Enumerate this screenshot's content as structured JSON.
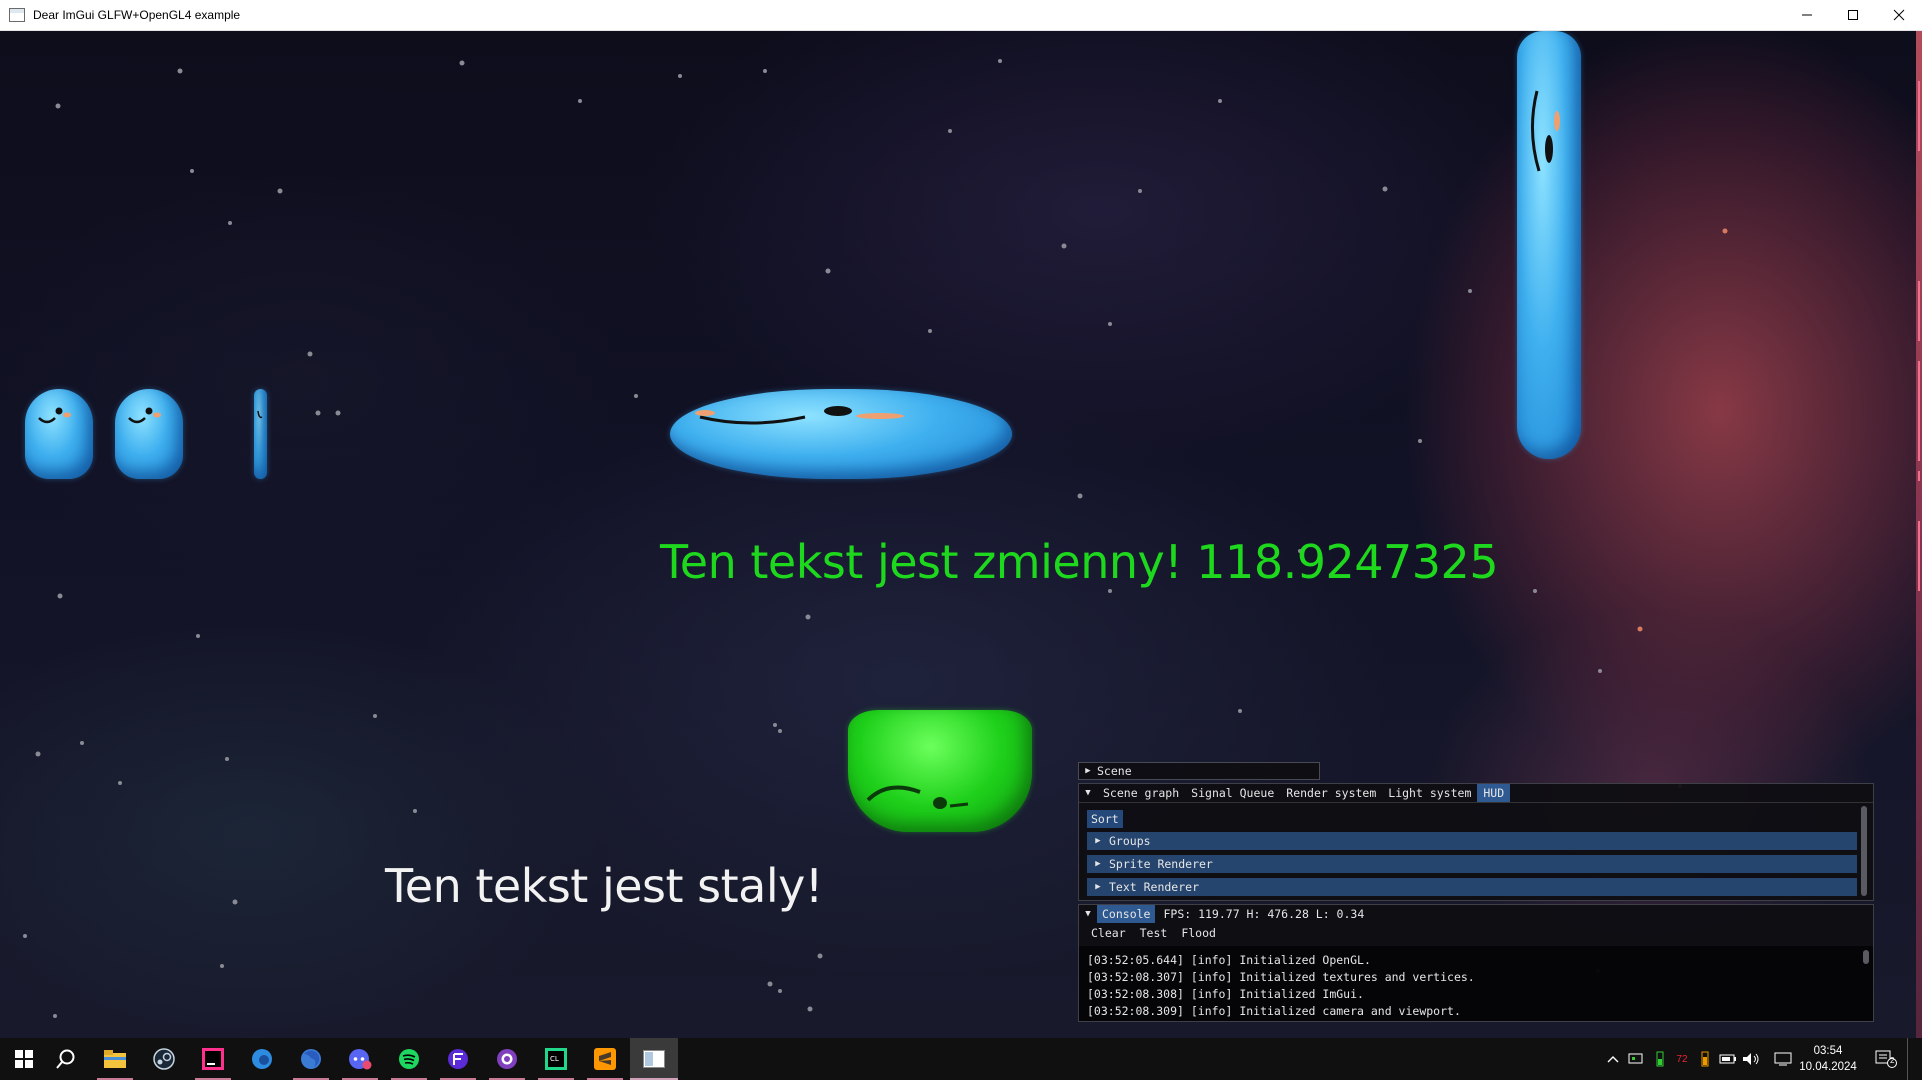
{
  "window": {
    "title": "Dear ImGui GLFW+OpenGL4 example"
  },
  "scene": {
    "dynamic_text": "Ten tekst jest zmienny! 118.9247325",
    "static_text": "Ten tekst jest staly!",
    "colors": {
      "dynamic_text": "#1ed81e",
      "static_text": "#f2f2f2",
      "blob_blue": "#3fb0ef",
      "blob_green": "#1ed01a"
    }
  },
  "imgui": {
    "scene_header": "Scene",
    "tabs": [
      "Scene graph",
      "Signal Queue",
      "Render system",
      "Light system",
      "HUD"
    ],
    "active_tab": "HUD",
    "sort_button": "Sort",
    "tree_items": [
      "Groups",
      "Sprite Renderer",
      "Text Renderer"
    ],
    "console": {
      "tab": "Console",
      "stats": "FPS: 119.77 H: 476.28 L: 0.34",
      "buttons": [
        "Clear",
        "Test",
        "Flood"
      ],
      "log": [
        "[03:52:05.644] [info] Initialized OpenGL.",
        "[03:52:08.307] [info] Initialized textures and vertices.",
        "[03:52:08.308] [info] Initialized ImGui.",
        "[03:52:08.309] [info] Initialized camera and viewport."
      ]
    },
    "colors": {
      "accent": "#2e5a91",
      "tree_row": "#25456f",
      "panel_bg": "#0e0e12"
    }
  },
  "taskbar": {
    "apps": [
      "start-icon",
      "search-icon",
      "file-explorer-icon",
      "steam-icon",
      "jetbrains-icon",
      "edge-icon",
      "firefox-icon",
      "discord-icon",
      "spotify-icon",
      "figma-icon",
      "github-desktop-icon",
      "clion-icon",
      "sublime-text-icon",
      "imgui-app-icon"
    ],
    "tray": {
      "temp_badge": "72",
      "notification_count": "2"
    },
    "clock": {
      "time": "03:54",
      "date": "10.04.2024"
    }
  }
}
